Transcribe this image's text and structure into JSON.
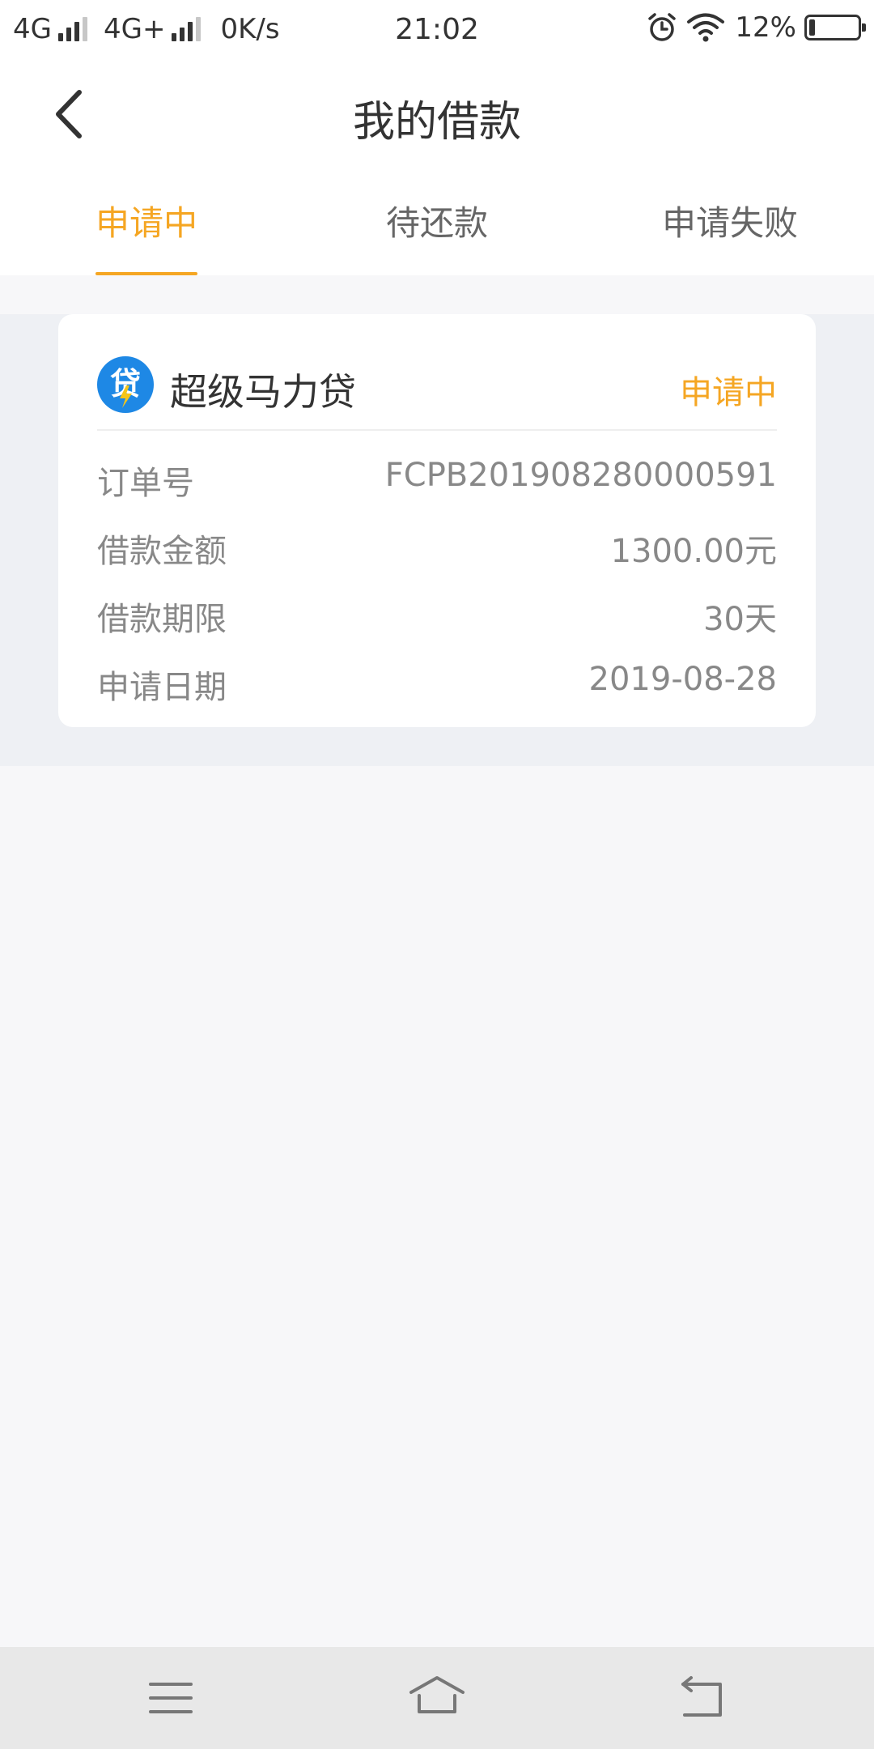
{
  "status_bar": {
    "network1": "4G",
    "network2": "4G+",
    "speed": "0K/s",
    "time": "21:02",
    "battery": "12%",
    "battery_level": 0.12
  },
  "header": {
    "title": "我的借款",
    "back_icon": "chevron-left-icon"
  },
  "tabs": [
    {
      "label": "申请中",
      "active": true
    },
    {
      "label": "待还款",
      "active": false
    },
    {
      "label": "申请失败",
      "active": false
    }
  ],
  "loan_card": {
    "lender_name": "超级马力贷",
    "status": "申请中",
    "logo_icon": "lender-logo-icon",
    "rows": [
      {
        "label": "订单号",
        "value": "FCPB201908280000591"
      },
      {
        "label": "借款金额",
        "value": "1300.00元"
      },
      {
        "label": "借款期限",
        "value": "30天"
      },
      {
        "label": "申请日期",
        "value": "2019-08-28"
      }
    ]
  },
  "nav_bar": {
    "menu_icon": "menu-icon",
    "home_icon": "home-icon",
    "back_icon": "back-icon"
  },
  "colors": {
    "accent": "#f5a623",
    "logo": "#1e88e5",
    "text": "#333333",
    "muted": "#888888"
  }
}
